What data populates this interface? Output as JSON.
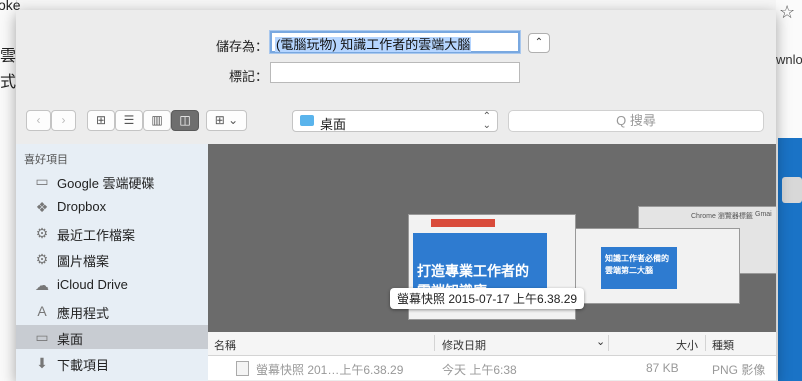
{
  "background": {
    "left_chars": [
      "oke",
      "雲",
      "式"
    ],
    "right_label": "wnloa",
    "star_glyph": "☆"
  },
  "save": {
    "save_as_label": "儲存為：",
    "filename_value": "(電腦玩物) 知識工作者的雲端大腦",
    "tags_label": "標記：",
    "tags_value": "",
    "expand_glyph": "⌃"
  },
  "toolbar": {
    "back": "‹",
    "forward": "›",
    "view_icons": "⊞",
    "view_list": "☰",
    "view_columns": "▥",
    "view_coverflow": "◫",
    "arrange": "⊞ ⌄",
    "location": "桌面",
    "search_placeholder": "Q 搜尋"
  },
  "sidebar": {
    "header": "喜好項目",
    "items": [
      {
        "label": "Google 雲端硬碟",
        "icon": "folder-icon",
        "glyph": "▭"
      },
      {
        "label": "Dropbox",
        "icon": "dropbox-icon",
        "glyph": "❖"
      },
      {
        "label": "最近工作檔案",
        "icon": "gear-icon",
        "glyph": "⚙"
      },
      {
        "label": "圖片檔案",
        "icon": "gear-icon",
        "glyph": "⚙"
      },
      {
        "label": "iCloud Drive",
        "icon": "cloud-icon",
        "glyph": "☁"
      },
      {
        "label": "應用程式",
        "icon": "apps-icon",
        "glyph": "A"
      },
      {
        "label": "桌面",
        "icon": "desktop-icon",
        "glyph": "▭"
      },
      {
        "label": "下載項目",
        "icon": "download-icon",
        "glyph": "⬇"
      }
    ],
    "selected_index": 6
  },
  "preview": {
    "caption": "螢幕快照 2015-07-17 上午6.38.29",
    "thumb_title_1": "打造專業工作者的",
    "thumb_title_2": "雲端知識庫",
    "thumb2_line1": "知識工作者必備的",
    "thumb2_line2": "雲端第二大腦",
    "thumb3_label_1": "Chrome 瀏覽器標籤",
    "thumb3_label_2": "Gmai"
  },
  "columns": {
    "name": "名稱",
    "date": "修改日期",
    "size": "大小",
    "kind": "種類",
    "sort_glyph": "⌄"
  },
  "files": [
    {
      "name": "螢幕快照 201…上午6.38.29",
      "date": "今天 上午6:38",
      "size": "87 KB",
      "kind": "PNG 影像"
    }
  ],
  "colors": {
    "selection": "#b5d5ff",
    "sidebar_bg": "#e7eef5",
    "preview_bg": "#6b6b6b",
    "folder_blue": "#5ab4ec",
    "accent_blue": "#2e7bd0"
  }
}
